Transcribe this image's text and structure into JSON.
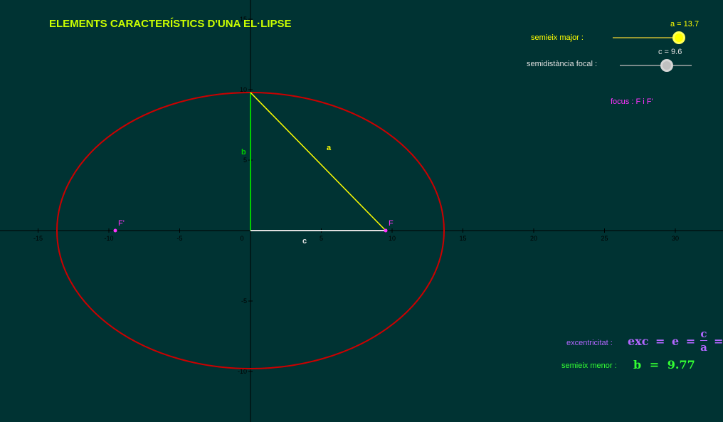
{
  "title": "ELEMENTS CARACTERÍSTICS D'UNA EL·LIPSE",
  "sliders": {
    "a": {
      "label": "semieix major :",
      "value_text": "a = 13.7",
      "value": 13.7,
      "min": 0,
      "max": 15,
      "color": "#ffff00"
    },
    "c": {
      "label": "semidistància focal :",
      "value_text": "c = 9.6",
      "value": 9.6,
      "min": 0,
      "max": 13,
      "color": "#e0e0e0"
    }
  },
  "focus_text": "focus : F i F'",
  "labels": {
    "a": "a",
    "b": "b",
    "c": "c",
    "F": "F",
    "F_prime": "F'"
  },
  "eccentricity": {
    "label": "excentricitat :",
    "formula_left": "exc",
    "formula_eq1": "=",
    "formula_e": "e",
    "formula_eq2": "=",
    "num": "c",
    "den": "a",
    "formula_eq3": "="
  },
  "minor_axis": {
    "label": "semieix menor :",
    "var": "b",
    "eq": "=",
    "value": "9.77"
  },
  "axes": {
    "x_ticks": [
      "-15",
      "-10",
      "-5",
      "0",
      "5",
      "10",
      "15",
      "20",
      "25",
      "30"
    ],
    "y_ticks": [
      "15",
      "10",
      "5",
      "-5",
      "-10"
    ]
  },
  "colors": {
    "background": "#003333",
    "ellipse": "#cc0000",
    "segment_a": "#ffff00",
    "segment_b": "#00cc00",
    "segment_c": "#e0e0e0",
    "focus": "#ff33ff",
    "title": "#ccff00",
    "eccentricity": "#b266ff",
    "minor": "#33ff33"
  }
}
